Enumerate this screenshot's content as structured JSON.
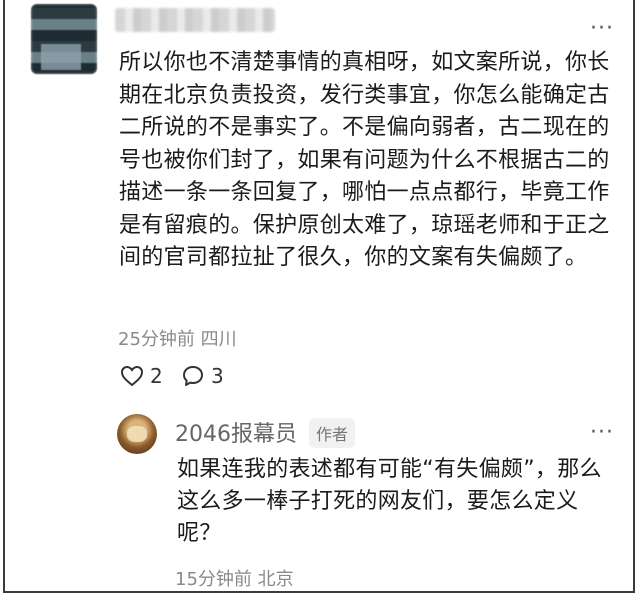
{
  "comment": {
    "text": "所以你也不清楚事情的真相呀，如文案所说，你长期在北京负责投资，发行类事宜，你怎么能确定古二所说的不是事实了。不是偏向弱者，古二现在的号也被你们封了，如果有问题为什么不根据古二的描述一条一条回复了，哪怕一点点都行，毕竟工作是有留痕的。保护原创太难了，琼瑶老师和于正之间的官司都拉扯了很久，你的文案有失偏颇了。",
    "time": "25分钟前",
    "location": "四川",
    "likes": "2",
    "replies": "3",
    "more_label": "···"
  },
  "reply": {
    "username": "2046报幕员",
    "badge": "作者",
    "text": "如果连我的表述都有可能“有失偏颇”，那么这么多一棒子打死的网友们，要怎么定义呢？",
    "time": "15分钟前",
    "location": "北京",
    "more_label": "···"
  }
}
